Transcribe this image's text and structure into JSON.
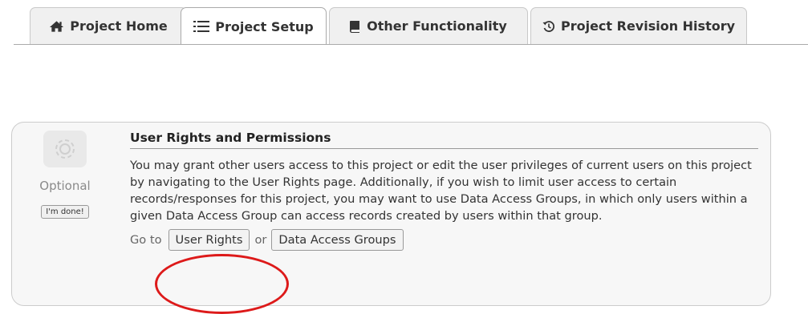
{
  "tabs": [
    {
      "label": "Project Home",
      "icon": "home-icon"
    },
    {
      "label": "Project Setup",
      "icon": "list-icon"
    },
    {
      "label": "Other Functionality",
      "icon": "book-icon"
    },
    {
      "label": "Project Revision History",
      "icon": "history-icon"
    }
  ],
  "active_tab": "Project Setup",
  "panel": {
    "status": "Optional",
    "done_label": "I'm done!",
    "title": "User Rights and Permissions",
    "description": "You may grant other users access to this project or edit the user privileges of current users on this project by navigating to the User Rights page. Additionally, if you wish to limit user access to certain records/responses for this project, you may want to use Data Access Groups, in which only users within a given Data Access Group can access records created by users within that group.",
    "goto_label": "Go to",
    "or_label": "or",
    "user_rights_label": "User Rights",
    "dag_label": "Data Access Groups"
  },
  "highlight_color": "#dd1a1a"
}
